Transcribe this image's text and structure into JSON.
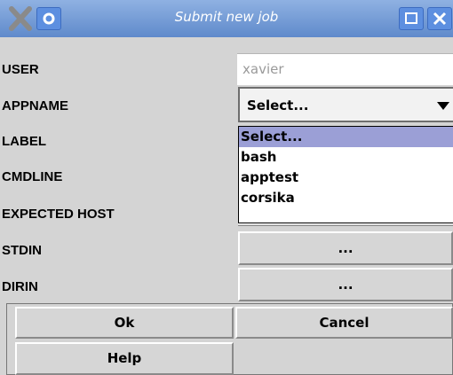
{
  "window": {
    "title": "Submit new job",
    "icons": [
      "close-x-icon",
      "settings-icon",
      "maximize-icon",
      "close-icon"
    ]
  },
  "form": {
    "labels": [
      "USER",
      "APPNAME",
      "LABEL",
      "CMDLINE",
      "EXPECTED HOST",
      "STDIN",
      "DIRIN"
    ],
    "user_value": "xavier",
    "appname_selected": "Select...",
    "appname_options": [
      "Select...",
      "bash",
      "apptest",
      "corsika"
    ],
    "stdin_button": "...",
    "dirin_button": "..."
  },
  "buttons": {
    "ok": "Ok",
    "cancel": "Cancel",
    "help": "Help"
  },
  "colors": {
    "titlebar": "#6b95d2",
    "highlight": "#9b9fd6"
  }
}
